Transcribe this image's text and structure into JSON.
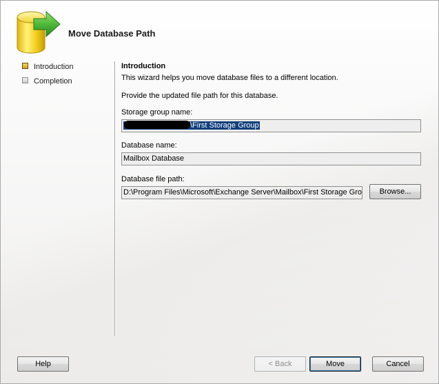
{
  "header": {
    "title": "Move Database Path",
    "icon": "database-move-icon"
  },
  "steps": [
    {
      "label": "Introduction",
      "active": true
    },
    {
      "label": "Completion",
      "active": false
    }
  ],
  "content": {
    "heading": "Introduction",
    "description": "This wizard helps you move database files to a different location.",
    "instruction": "Provide the updated file path for this database.",
    "storage_group": {
      "label": "Storage group name:",
      "value_visible": "\\First Storage Group"
    },
    "database_name": {
      "label": "Database name:",
      "value": "Mailbox Database"
    },
    "database_file_path": {
      "label": "Database file path:",
      "value": "D:\\Program Files\\Microsoft\\Exchange Server\\Mailbox\\First Storage Group"
    },
    "browse_label": "Browse..."
  },
  "footer": {
    "help_label": "Help",
    "back_label": "< Back",
    "move_label": "Move",
    "cancel_label": "Cancel"
  },
  "colors": {
    "selection": "#103f7c",
    "active_step": "#d8a21c",
    "icon_cylinder": "#f2d21e",
    "icon_arrow": "#4fb83a"
  }
}
